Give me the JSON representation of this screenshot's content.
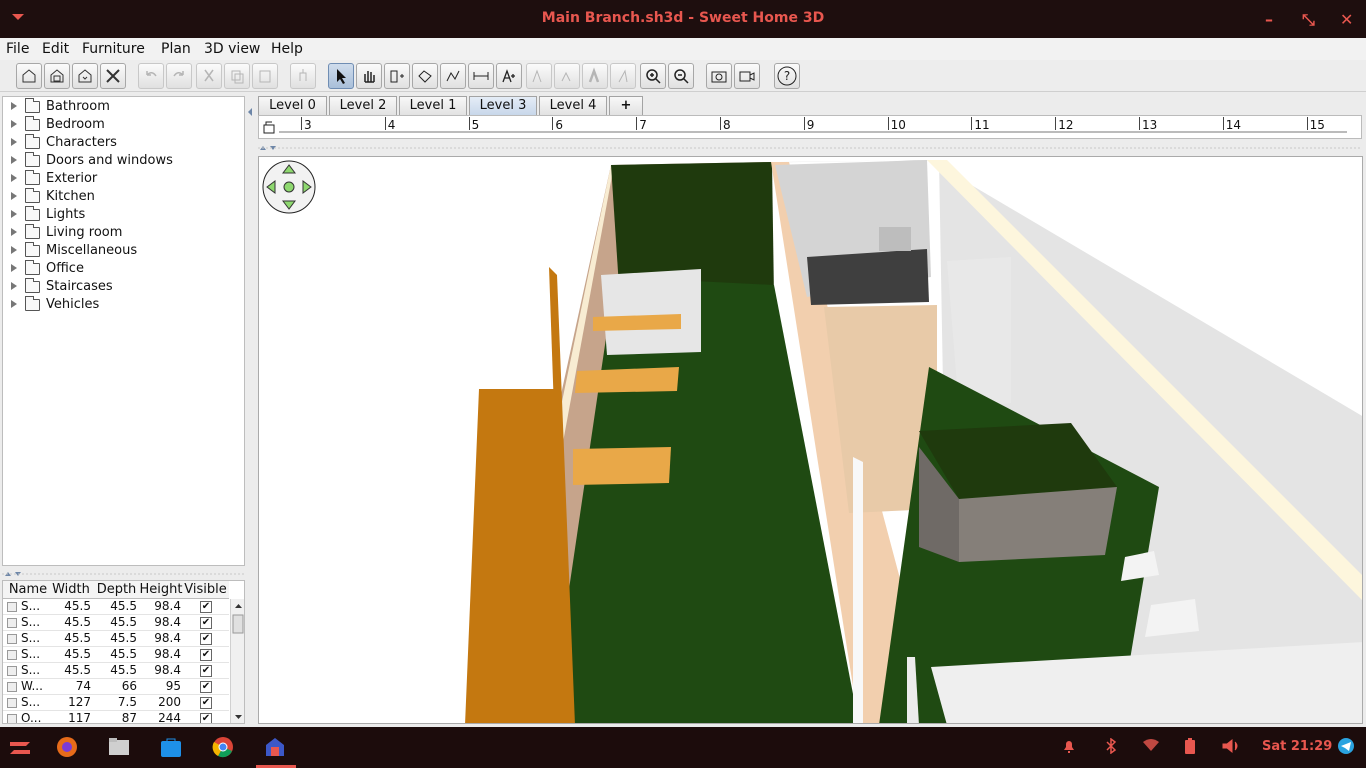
{
  "window": {
    "title": "Main Branch.sh3d - Sweet Home 3D",
    "minimize": "–",
    "maximize": "⤡",
    "close": "✕"
  },
  "menu": {
    "items": [
      "File",
      "Edit",
      "Furniture",
      "Plan",
      "3D view",
      "Help"
    ]
  },
  "toolbar": {
    "buttons": [
      "new-home",
      "open",
      "save",
      "preferences",
      "undo",
      "redo",
      "cut",
      "copy",
      "paste",
      "add-furniture",
      "select",
      "pan",
      "create-walls",
      "create-rooms",
      "create-polylines",
      "create-dimensions",
      "add-text",
      "increase-text",
      "decrease-text",
      "bold",
      "italic",
      "zoom-in",
      "zoom-out",
      "create-photo",
      "create-video",
      "help"
    ],
    "help_label": "?"
  },
  "catalog": {
    "categories": [
      "Bathroom",
      "Bedroom",
      "Characters",
      "Doors and windows",
      "Exterior",
      "Kitchen",
      "Lights",
      "Living room",
      "Miscellaneous",
      "Office",
      "Staircases",
      "Vehicles"
    ]
  },
  "furniture_table": {
    "headers": [
      "Name",
      "Width",
      "Depth",
      "Height",
      "Visible"
    ],
    "rows": [
      {
        "name": "S...",
        "width": "45.5",
        "depth": "45.5",
        "height": "98.4",
        "visible": "✔"
      },
      {
        "name": "S...",
        "width": "45.5",
        "depth": "45.5",
        "height": "98.4",
        "visible": "✔"
      },
      {
        "name": "S...",
        "width": "45.5",
        "depth": "45.5",
        "height": "98.4",
        "visible": "✔"
      },
      {
        "name": "S...",
        "width": "45.5",
        "depth": "45.5",
        "height": "98.4",
        "visible": "✔"
      },
      {
        "name": "S...",
        "width": "45.5",
        "depth": "45.5",
        "height": "98.4",
        "visible": "✔"
      },
      {
        "name": "W...",
        "width": "74",
        "depth": "66",
        "height": "95",
        "visible": "✔"
      },
      {
        "name": "S...",
        "width": "127",
        "depth": "7.5",
        "height": "200",
        "visible": "✔"
      },
      {
        "name": "O...",
        "width": "117",
        "depth": "87",
        "height": "244",
        "visible": "✔"
      }
    ]
  },
  "levels": {
    "tabs": [
      "Level 0",
      "Level 2",
      "Level 1",
      "Level 3",
      "Level 4"
    ],
    "active": "Level 3",
    "add_label": "+"
  },
  "ruler": {
    "marks": [
      "3",
      "4",
      "5",
      "6",
      "7",
      "8",
      "9",
      "10",
      "11",
      "12",
      "13",
      "14",
      "15"
    ]
  },
  "taskbar": {
    "clock": "Sat 21:29"
  }
}
